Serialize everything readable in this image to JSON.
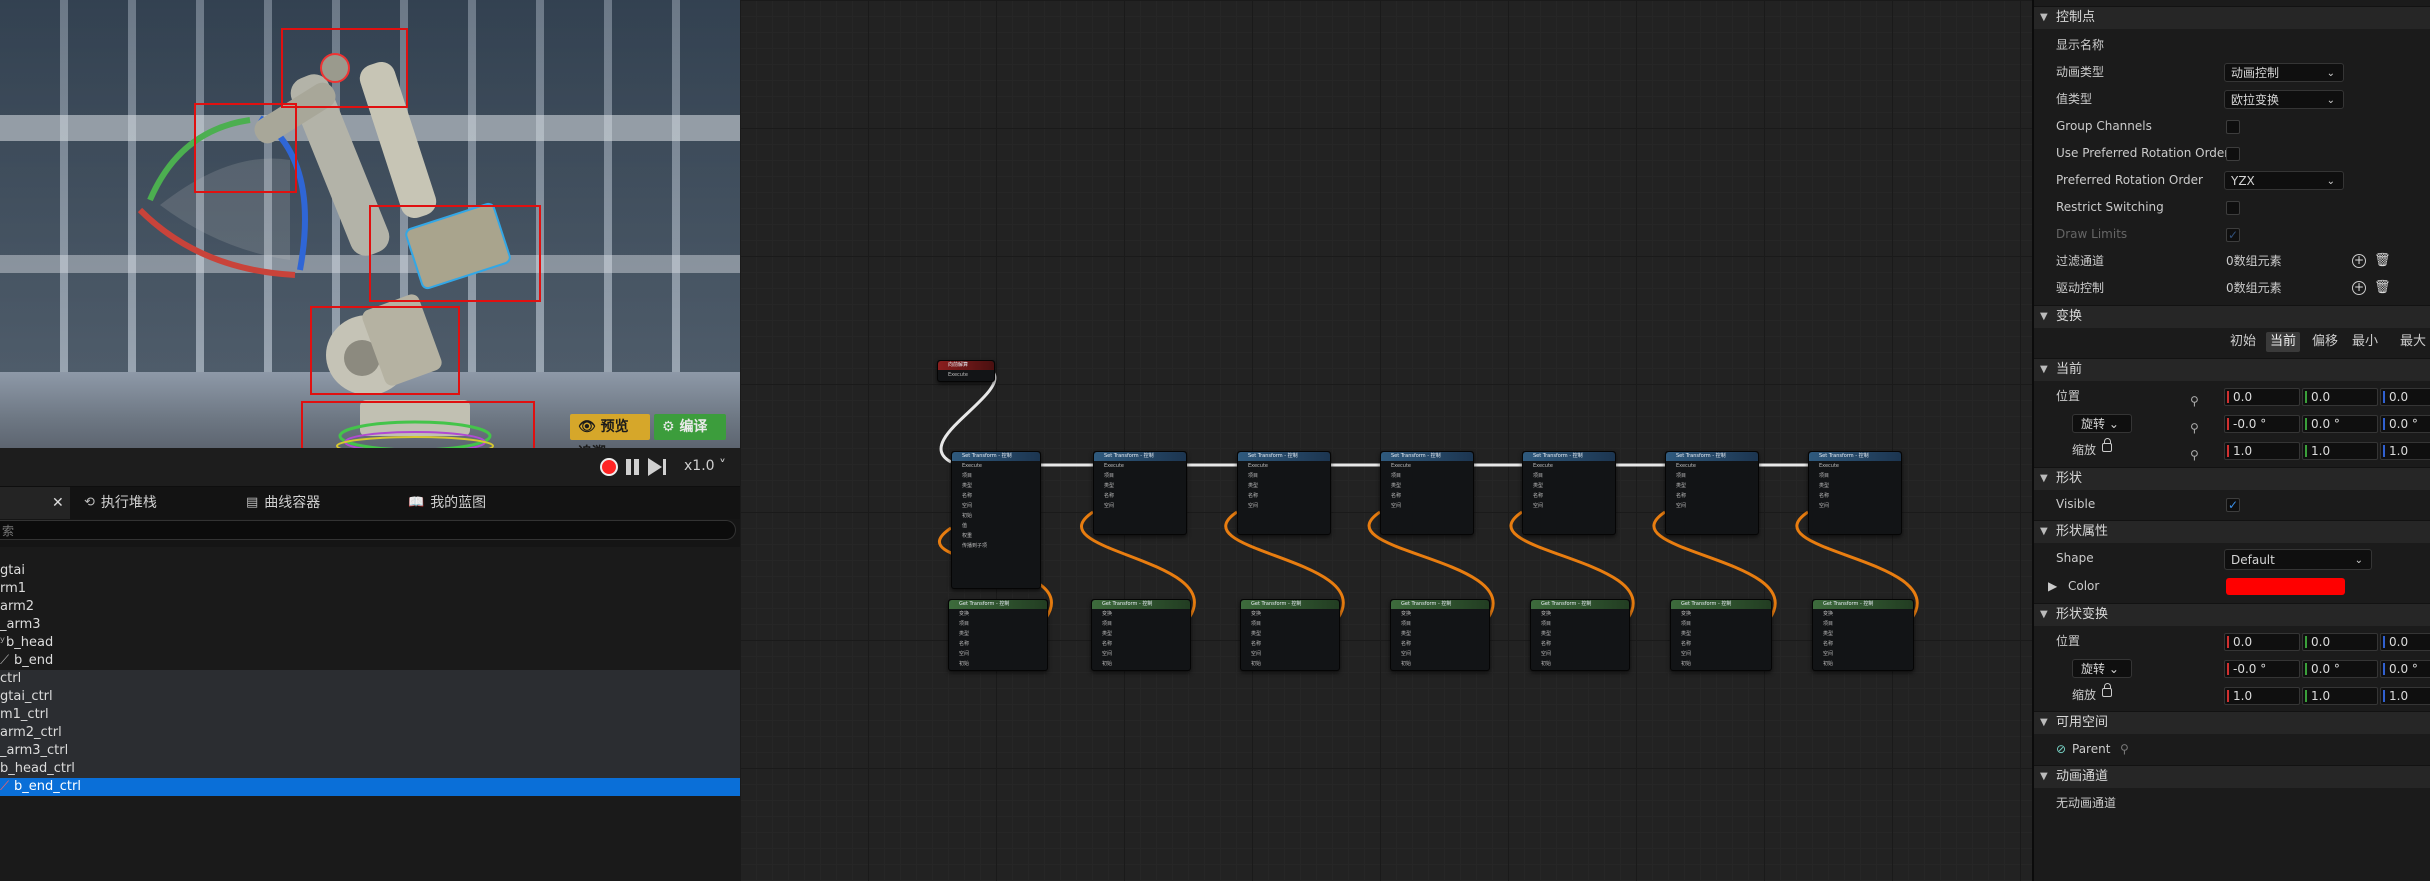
{
  "viewport": {
    "preview_label": "预览追溯",
    "compile_label": "编译"
  },
  "playback": {
    "speed": "x1.0"
  },
  "tabs": [
    {
      "label": ""
    },
    {
      "label": "执行堆栈"
    },
    {
      "label": "曲线容器"
    },
    {
      "label": "我的蓝图"
    }
  ],
  "search": {
    "placeholder": "索"
  },
  "hierarchy": [
    "gtai",
    "rm1",
    "arm2",
    "_arm3",
    "b_head",
    "b_end",
    "ctrl",
    "gtai_ctrl",
    "m1_ctrl",
    "arm2_ctrl",
    "_arm3_ctrl",
    "b_head_ctrl",
    "b_end_ctrl"
  ],
  "graph": {
    "event_node": {
      "title": "向前解算",
      "pin": "Execute"
    },
    "set_transform_title": "Set Transform - 控制",
    "get_transform_title": "Get Transform - 控制",
    "pins": [
      "Execute",
      "项目",
      "类型",
      "名称",
      "空间",
      "初始",
      "值",
      "权重",
      "传播到子项"
    ],
    "get_pins": [
      "变换",
      "项目",
      "类型",
      "名称",
      "空间",
      "初始"
    ]
  },
  "details": {
    "sections": {
      "control": "控制点",
      "transform": "变换",
      "current": "当前",
      "shape": "形状",
      "shape_props": "形状属性",
      "shape_transform": "形状变换",
      "available_space": "可用空间",
      "anim_channels": "动画通道"
    },
    "rows": {
      "display_name": "显示名称",
      "anim_type": "动画类型",
      "anim_type_value": "动画控制",
      "value_type": "值类型",
      "value_type_value": "欧拉变换",
      "group_channels": "Group Channels",
      "use_pref_rot": "Use Preferred Rotation Order",
      "pref_rot": "Preferred Rotation Order",
      "pref_rot_value": "YZX",
      "restrict_switching": "Restrict Switching",
      "draw_limits": "Draw Limits",
      "filter_channels": "过滤通道",
      "filter_channels_value": "0数组元素",
      "driven_controls": "驱动控制",
      "driven_controls_value": "0数组元素",
      "visible": "Visible",
      "shape": "Shape",
      "shape_value": "Default",
      "color": "Color",
      "parent": "Parent",
      "no_channels": "无动画通道"
    },
    "transform_tabs": [
      "初始",
      "当前",
      "偏移",
      "最小",
      "最大"
    ],
    "location_label": "位置",
    "rotation_label": "旋转",
    "scale_label": "缩放",
    "current": {
      "location": [
        "0.0",
        "0.0",
        "0.0"
      ],
      "rotation": [
        "-0.0 °",
        "0.0 °",
        "0.0 °"
      ],
      "scale": [
        "1.0",
        "1.0",
        "1.0"
      ]
    },
    "shape_transform": {
      "location": [
        "0.0",
        "0.0",
        "0.0"
      ],
      "rotation": [
        "-0.0 °",
        "0.0 °",
        "0.0 °"
      ],
      "scale": [
        "1.0",
        "1.0",
        "1.0"
      ]
    },
    "colors": {
      "shape_color": "#ff0000",
      "accent": "#0a6fd8"
    }
  }
}
